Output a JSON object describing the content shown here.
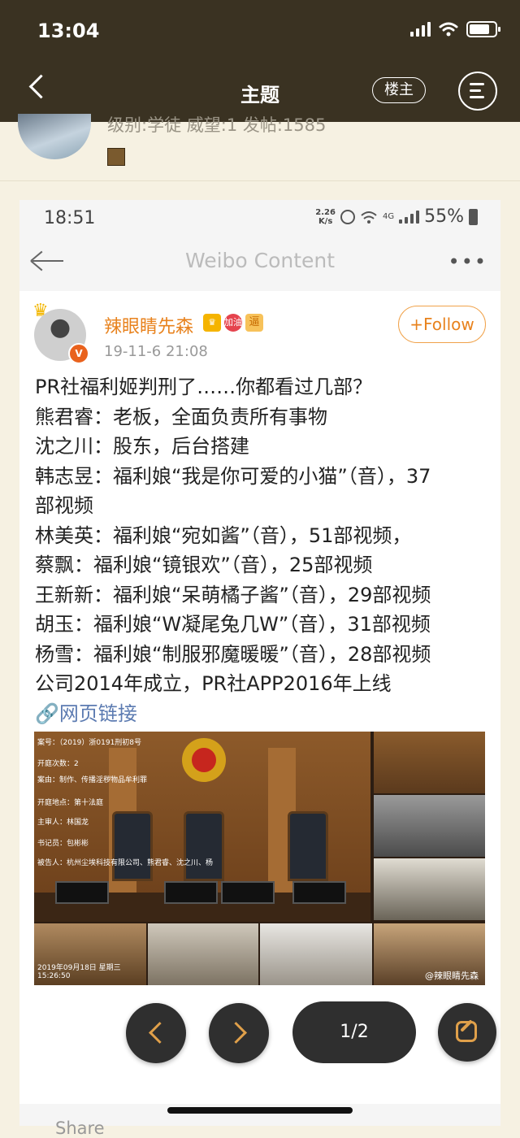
{
  "app": {
    "status_time": "13:04",
    "nav_title": "主题",
    "op_label": "楼主"
  },
  "user_strip": {
    "meta": "级别:学徒  威望:1  发帖:1585"
  },
  "inner": {
    "status_time": "18:51",
    "speed_top": "2.26",
    "speed_bottom": "K/s",
    "network": "4G",
    "battery_pct": "55%",
    "nav_title": "Weibo Content",
    "more": "•••"
  },
  "post": {
    "author": "辣眼睛先森",
    "badge_vip": "加油",
    "badge_tag": "逼",
    "time": "19-11-6 21:08",
    "follow_label": "+Follow",
    "lines": [
      "PR社福利姬判刑了……你都看过几部？",
      "熊君睿：老板，全面负责所有事物",
      "沈之川：股东，后台搭建",
      "韩志昱：福利娘“我是你可爱的小猫”（音），37",
      "部视频",
      "林美英：福利娘“宛如酱”（音），51部视频，",
      "蔡飘：福利娘“镜银欢”（音），25部视频",
      "王新新：福利娘“呆萌橘子酱”（音），29部视频",
      "胡玉：福利娘“W凝尾兔几W”（音），31部视频",
      "杨雪：福利娘“制服邪魔暖暖”（音），28部视频",
      "公司2014年成立，PR社APP2016年上线"
    ],
    "link_label": "🔗网页链接",
    "image": {
      "overlay_lines": [
        "案号：（2019）浙0191刑初8号",
        "开庭次数：2",
        "案由：制作、传播淫秽物品牟利罪",
        "开庭地点：第十法庭",
        "主审人：林国龙",
        "书记员：包彬彬",
        "被告人：杭州尘埃科技有限公司、熊君睿、沈之川、杨"
      ],
      "date_overlay": "2019年09月18日 星期三 15:26:50",
      "watermark": "@辣眼睛先森"
    },
    "share_label": "Share"
  },
  "controls": {
    "pager": "1/2"
  }
}
